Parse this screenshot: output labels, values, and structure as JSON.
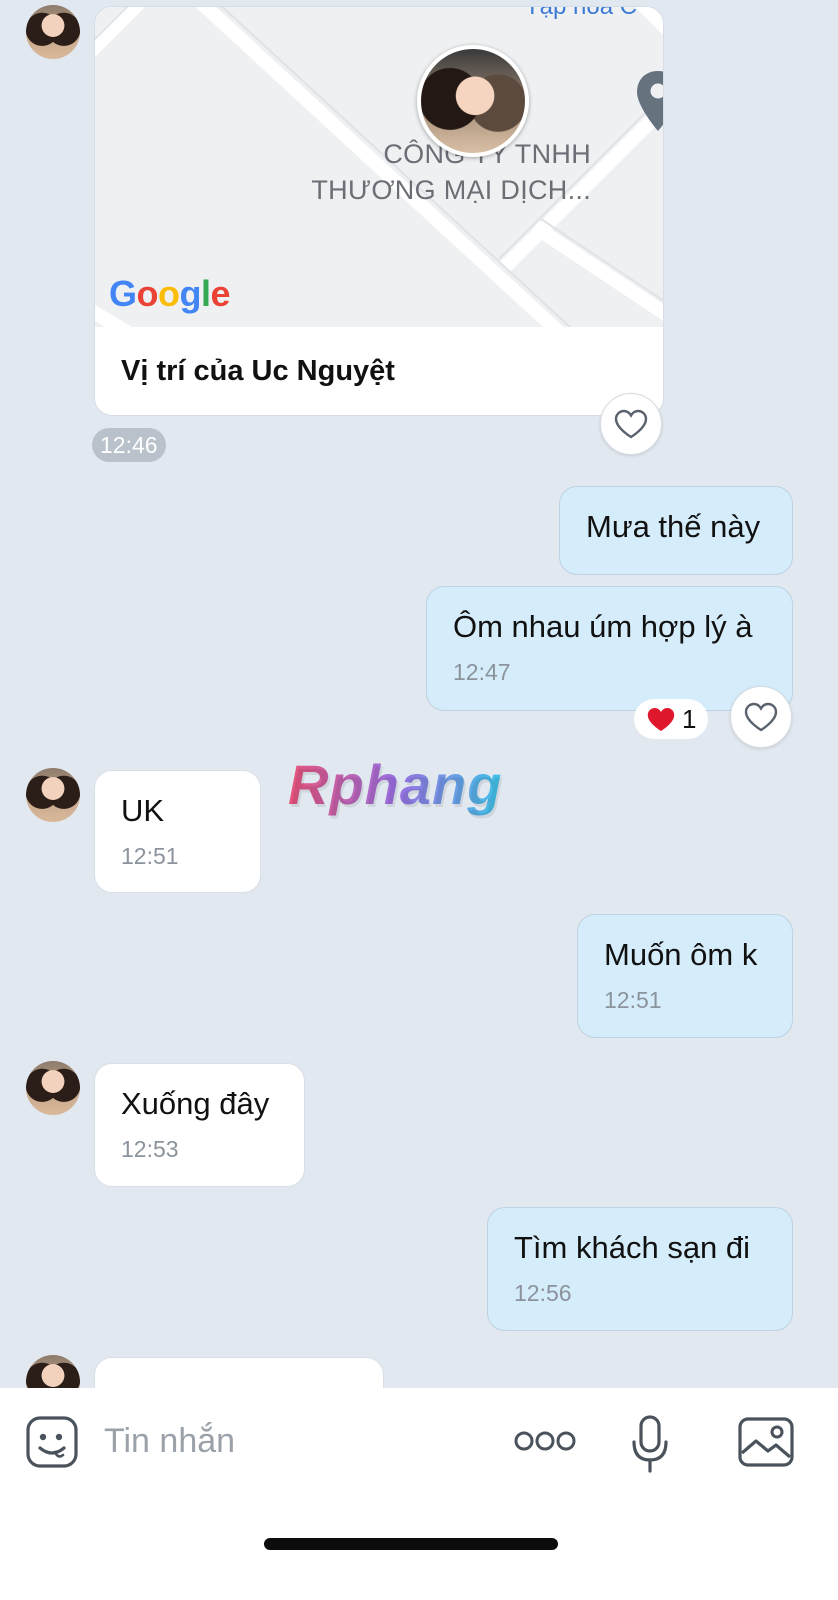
{
  "location_card": {
    "top_label": "Tạp hoá C",
    "place_line1": "CÔNG TY TNHH",
    "place_line2": "THƯƠNG MẠI DỊCH...",
    "caption": "Vị trí của Uc Nguyệt",
    "time": "12:46"
  },
  "messages": [
    {
      "side": "me",
      "text": "Mưa thế này",
      "time": ""
    },
    {
      "side": "me",
      "text": "Ôm nhau úm hợp lý à",
      "time": "12:47",
      "reaction_count": "1"
    },
    {
      "side": "them",
      "text": "UK",
      "time": "12:51"
    },
    {
      "side": "me",
      "text": "Muốn ôm k",
      "time": "12:51"
    },
    {
      "side": "them",
      "text": "Xuống đây",
      "time": "12:53"
    },
    {
      "side": "me",
      "text": "Tìm khách sạn đi",
      "time": "12:56"
    }
  ],
  "watermark": "Rphang",
  "composer": {
    "placeholder": "Tin nhắn"
  },
  "colors": {
    "background": "#e1e8f0",
    "my_bubble": "#d5ecfa",
    "their_bubble": "#ffffff",
    "heart_red": "#e0182d"
  }
}
